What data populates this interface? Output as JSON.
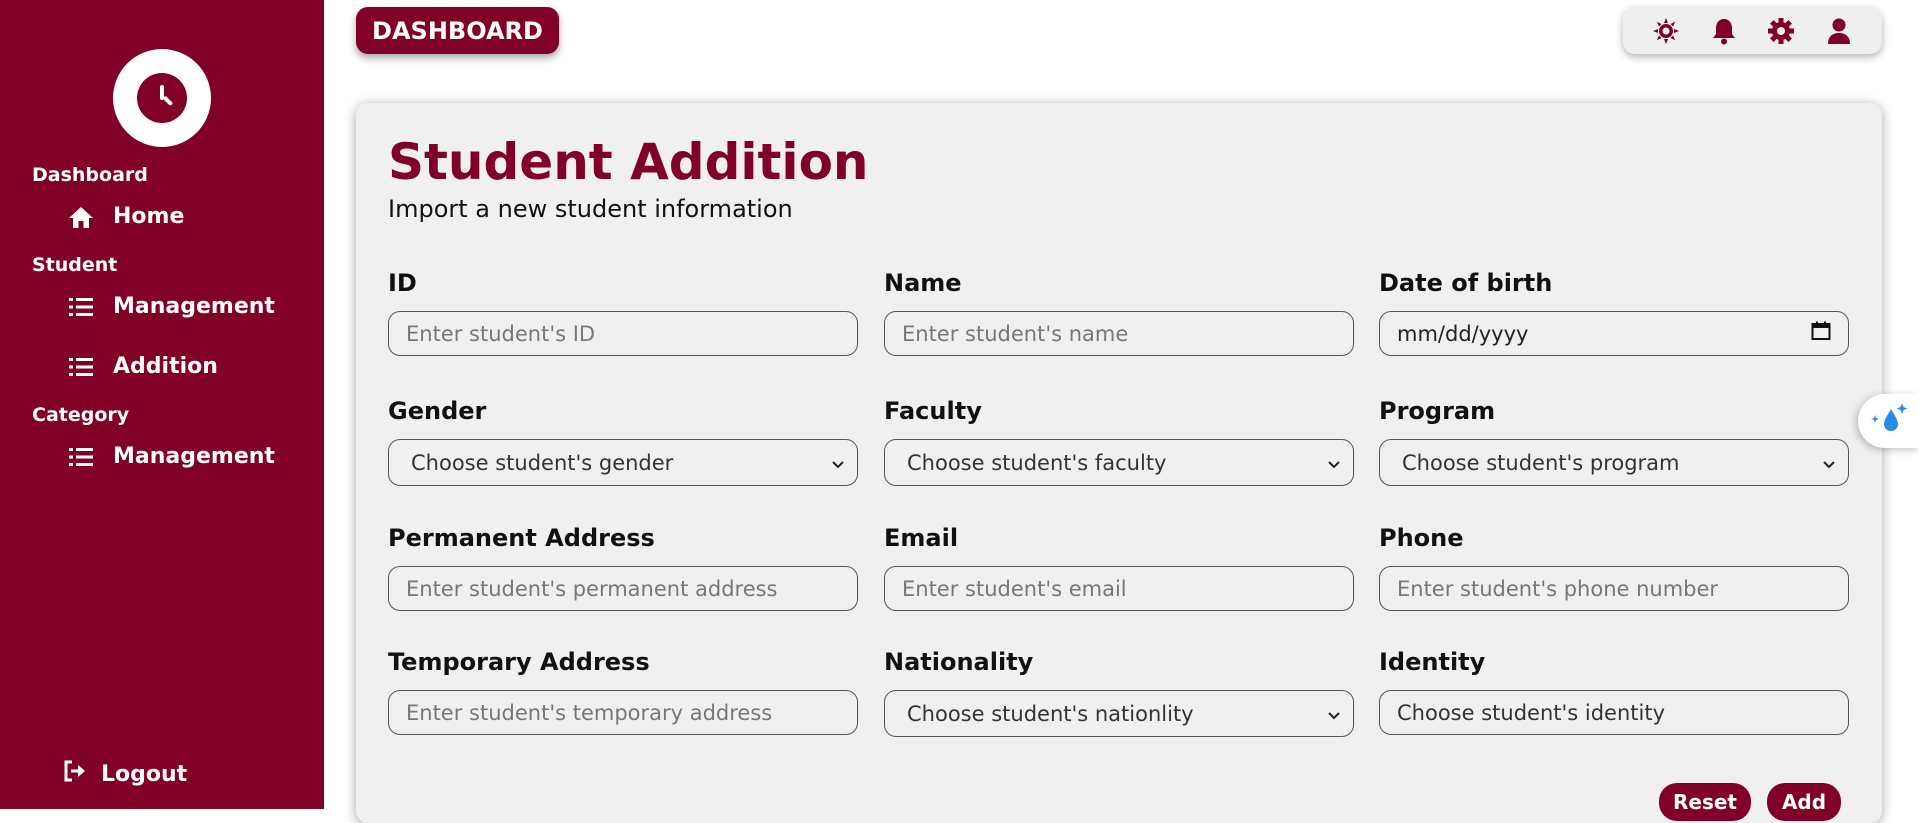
{
  "sidebar": {
    "sections": [
      {
        "title": "Dashboard",
        "items": [
          {
            "label": "Home",
            "icon": "home-icon"
          }
        ]
      },
      {
        "title": "Student",
        "items": [
          {
            "label": "Management",
            "icon": "list-icon"
          },
          {
            "label": "Addition",
            "icon": "list-icon"
          }
        ]
      },
      {
        "title": "Category",
        "items": [
          {
            "label": "Management",
            "icon": "list-icon"
          }
        ]
      }
    ],
    "logout_label": "Logout"
  },
  "header": {
    "dashboard_label": "DASHBOARD",
    "icons": [
      "sun-icon",
      "bell-icon",
      "gear-icon",
      "user-icon"
    ]
  },
  "form": {
    "title": "Student Addition",
    "subtitle": "Import a new student information",
    "fields": [
      {
        "label": "ID",
        "placeholder": "Enter student's ID",
        "kind": "text"
      },
      {
        "label": "Name",
        "placeholder": "Enter student's name",
        "kind": "text"
      },
      {
        "label": "Date of birth",
        "placeholder": "mm/dd/yyyy",
        "kind": "date"
      },
      {
        "label": "Gender",
        "placeholder": "Choose student's gender",
        "kind": "select"
      },
      {
        "label": "Faculty",
        "placeholder": "Choose student's faculty",
        "kind": "select"
      },
      {
        "label": "Program",
        "placeholder": "Choose student's program",
        "kind": "select"
      },
      {
        "label": "Permanent Address",
        "placeholder": "Enter student's permanent address",
        "kind": "text"
      },
      {
        "label": "Email",
        "placeholder": "Enter student's email",
        "kind": "text"
      },
      {
        "label": "Phone",
        "placeholder": "Enter student's phone number",
        "kind": "text"
      },
      {
        "label": "Temporary Address",
        "placeholder": "Enter student's temporary address",
        "kind": "text"
      },
      {
        "label": "Nationality",
        "placeholder": "Choose student's nationlity",
        "kind": "select"
      },
      {
        "label": "Identity",
        "placeholder": "Choose student's identity",
        "kind": "text"
      }
    ],
    "reset_label": "Reset",
    "add_label": "Add"
  },
  "colors": {
    "brand": "#800027",
    "card_bg": "#f0f0f0"
  }
}
